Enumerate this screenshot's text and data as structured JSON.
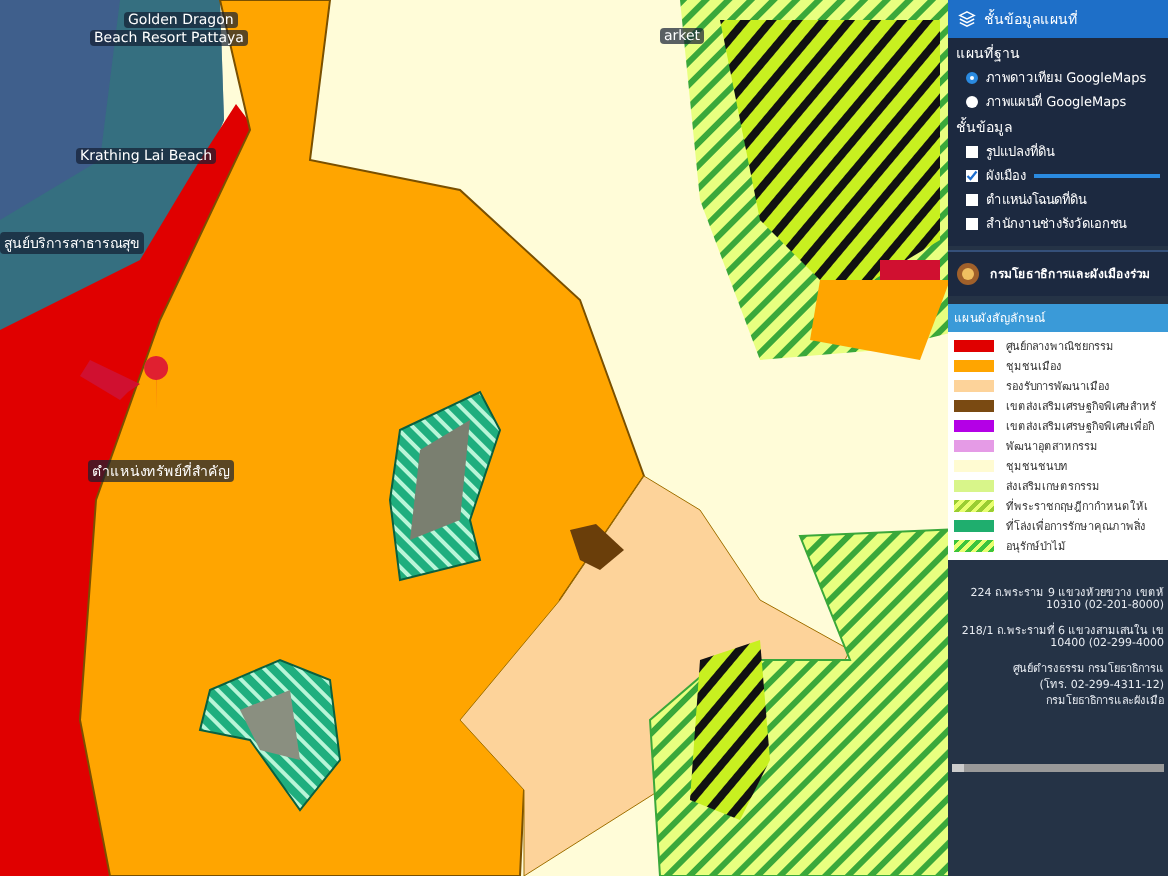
{
  "map": {
    "labels": [
      "Golden Dragon",
      "Beach Resort Pattaya",
      "Krathing Lai Beach",
      "สูนย์บริการสาธารณสุข",
      "ตำแหน่งทรัพย์ที่สำคัญ",
      "arket"
    ]
  },
  "panel": {
    "title": "ชั้นข้อมูลแผนที่",
    "basemap_heading": "แผนที่ฐาน",
    "basemaps": [
      {
        "label": "ภาพดาวเทียม GoogleMaps",
        "selected": true
      },
      {
        "label": "ภาพแผนที่ GoogleMaps",
        "selected": false
      }
    ],
    "layers_heading": "ชั้นข้อมูล",
    "layers": [
      {
        "label": "รูปแปลงที่ดิน",
        "checked": false
      },
      {
        "label": "ผังเมือง",
        "checked": true,
        "level": 1
      },
      {
        "label": "ตำแหน่งโฉนดที่ดิน",
        "checked": false
      },
      {
        "label": "สำนักงานช่างรังวัดเอกชน",
        "checked": false
      }
    ],
    "agency": "กรมโยธาธิการและผังเมืองร่วม",
    "legend_title": "แผนผังสัญลักษณ์",
    "legend": [
      {
        "label": "ศูนย์กลางพาณิชยกรรม",
        "kind": "solid",
        "color": "#e00000"
      },
      {
        "label": "ชุมชนเมือง",
        "kind": "solid",
        "color": "#ffa500"
      },
      {
        "label": "รองรับการพัฒนาเมือง",
        "kind": "solid",
        "color": "#fdd39a"
      },
      {
        "label": "เขตส่งเสริมเศรษฐกิจพิเศษสำหรั",
        "kind": "solid",
        "color": "#7a4a12"
      },
      {
        "label": "เขตส่งเสริมเศรษฐกิจพิเศษเพื่อกิ",
        "kind": "solid",
        "color": "#b400e6"
      },
      {
        "label": "พัฒนาอุตสาหกรรม",
        "kind": "solid",
        "color": "#e59be6"
      },
      {
        "label": "ชุมชนชนบท",
        "kind": "solid",
        "color": "#fffbd2"
      },
      {
        "label": "ส่งเสริมเกษตรกรรม",
        "kind": "solid",
        "color": "#d8f58a"
      },
      {
        "label": "ที่พระราชกฤษฎีกากำหนดให้เ",
        "kind": "hatch",
        "color": "#9acd32"
      },
      {
        "label": "ที่โล่งเพื่อการรักษาคุณภาพสิ่ง",
        "kind": "solid",
        "color": "#1fae6e"
      },
      {
        "label": "อนุรักษ์ป่าไม้",
        "kind": "hatch",
        "color": "#3cc43c"
      }
    ],
    "contacts": [
      "224 ถ.พระราม 9 แขวงห้วยขวาง เขตห้",
      "10310 (02-201-8000)",
      "218/1 ถ.พระรามที่ 6 แขวงสามเสนใน เข",
      "10400 (02-299-4000",
      "ศูนย์ดำรงธรรม กรมโยธาธิการแ",
      "(โทร. 02-299-4311-12)",
      "กรมโยธาธิการและผังเมือ"
    ]
  }
}
